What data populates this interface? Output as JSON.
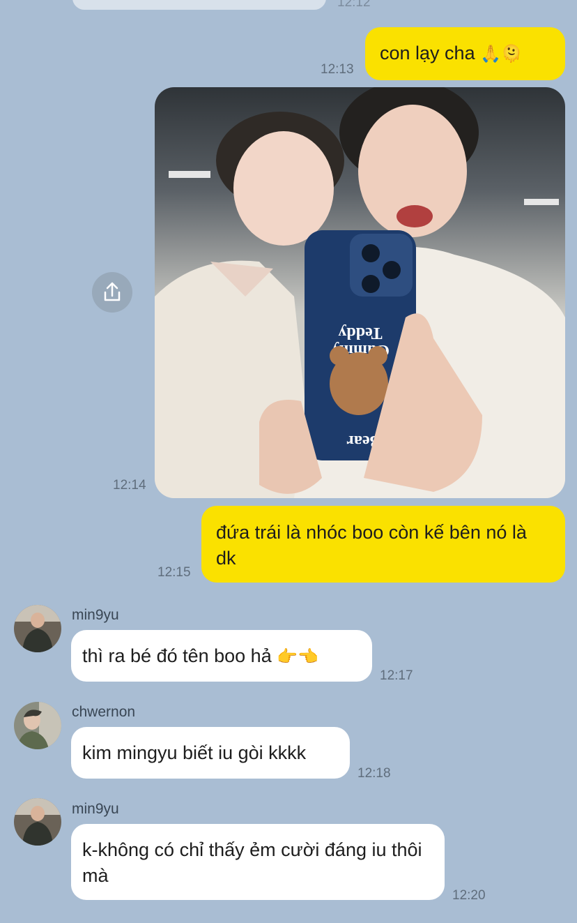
{
  "messages": [
    {
      "id": "m1",
      "side": "out",
      "text": "con lạy cha",
      "emoji": "🙏🫠",
      "time": "12:13"
    },
    {
      "id": "m2",
      "side": "out",
      "type": "photo",
      "time": "12:14",
      "photo": {
        "phone_case_text": [
          "Teddy",
          "Gummy",
          "Bear"
        ]
      }
    },
    {
      "id": "m3",
      "side": "out",
      "text": "đứa trái là nhóc boo còn kế bên nó là dk",
      "time": "12:15"
    },
    {
      "id": "m4",
      "side": "in",
      "sender": "min9yu",
      "text": "thì ra bé đó tên boo hả",
      "emoji": "👉👈",
      "time": "12:17"
    },
    {
      "id": "m5",
      "side": "in",
      "sender": "chwernon",
      "text": "kim mingyu biết iu gòi kkkk",
      "time": "12:18"
    },
    {
      "id": "m6",
      "side": "in",
      "sender": "min9yu",
      "text": "k-không có chỉ thấy ẻm cười đáng iu thôi mà",
      "time": "12:20"
    }
  ],
  "icons": {
    "share": "share-icon"
  },
  "colors": {
    "background": "#a9bdd3",
    "outgoing": "#fae100",
    "incoming": "#ffffff"
  },
  "top_partial_time": "12:12"
}
